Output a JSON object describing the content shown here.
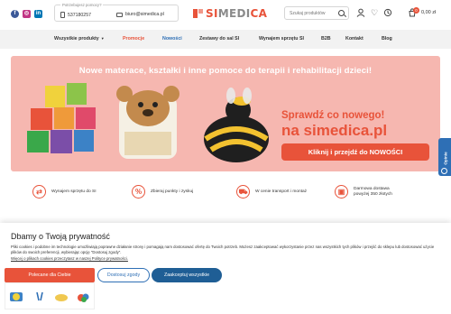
{
  "social": {
    "icons": [
      "facebook-icon",
      "instagram-icon",
      "linkedin-icon"
    ]
  },
  "contact": {
    "hint": "Potrzebujesz pomocy?",
    "phone": "537180257",
    "email": "biuro@simedica.pl"
  },
  "brand": {
    "logo_prefix": "SI",
    "logo_main": "MEDI",
    "logo_suffix": "CA",
    "accent": "#e8533a",
    "blue": "#2e6fb5"
  },
  "search": {
    "placeholder": "Szukaj produktów"
  },
  "cart": {
    "count": "0",
    "total": "0,00 zł"
  },
  "nav": {
    "items": [
      {
        "label": "Wszystkie produkty"
      },
      {
        "label": "Promocje"
      },
      {
        "label": "Nowości"
      },
      {
        "label": "Zestawy do sal SI"
      },
      {
        "label": "Wynajem sprzętu SI"
      },
      {
        "label": "B2B"
      },
      {
        "label": "Kontakt"
      },
      {
        "label": "Blog"
      }
    ]
  },
  "banner": {
    "headline": "Nowe materace, kształki i inne pomoce do terapii i rehabilitacji dzieci!",
    "subline": "Sprawdź co nowego!",
    "url": "na simedica.pl",
    "cta": "Kliknij i przejdź do NOWOŚCI"
  },
  "side_tab": {
    "label": "Opinie"
  },
  "features": [
    {
      "icon": "rental-icon",
      "text": "Wynajem sprzętu do SI"
    },
    {
      "icon": "percent-icon",
      "text": "Zbieraj punkty i zyskuj"
    },
    {
      "icon": "truck-icon",
      "text": "W cenie transport i montaż"
    },
    {
      "icon": "delivery-icon",
      "text": "Darmowa dostawa powyżej 350 złotych"
    }
  ],
  "cookie": {
    "title": "Dbamy o Twoją prywatność",
    "text": "Pliki cookies i podobne im technologie umożliwiają poprawne działanie strony i pomagają nam dostosować ofertę do Twoich potrzeb. Możesz zaakceptować wykorzystanie przez nas wszystkich tych plików i przejść do sklepu lub dostosować użycie plików do swoich preferencji, wybierając opcję \"Dostosuj zgody\".",
    "link": "Więcej o plikach cookies przeczytasz w naszej Polityce prywatności.",
    "btn_recommended": "Polecane dla Ciebie",
    "btn_customize": "Dostosuj zgody",
    "btn_accept": "Zaakceptuj wszystkie"
  }
}
